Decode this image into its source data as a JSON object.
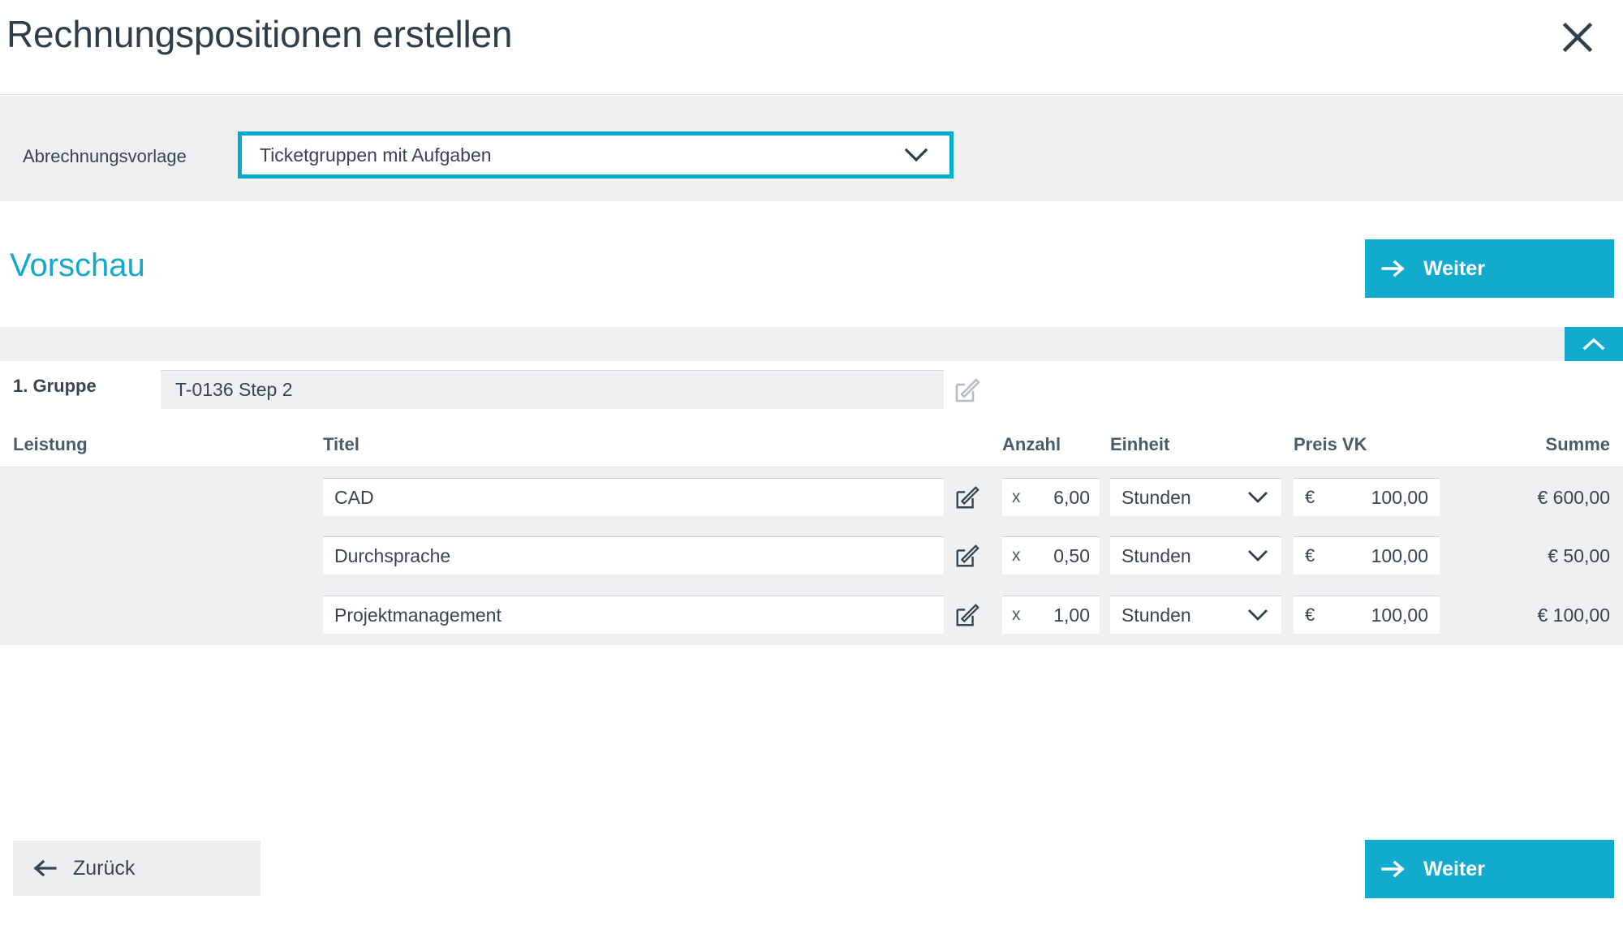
{
  "header": {
    "title": "Rechnungspositionen erstellen",
    "close_icon": "close-icon"
  },
  "template_bar": {
    "label": "Abrechnungsvorlage",
    "select": {
      "value": "Ticketgruppen mit Aufgaben",
      "chevron_icon": "chevron-down-icon",
      "highlight_color": "#00ABCF"
    }
  },
  "preview": {
    "title": "Vorschau",
    "title_color": "#14A8CC",
    "next_button": {
      "label": "Weiter",
      "icon": "arrow-right-icon",
      "color": "#12ABCE"
    },
    "collapse_button": {
      "icon": "chevron-up-icon",
      "color": "#12ABCE"
    }
  },
  "group": {
    "label": "1. Gruppe",
    "value": "T-0136 Step 2",
    "edit_icon": "edit-pencil-icon"
  },
  "table": {
    "columns": [
      "Leistung",
      "Titel",
      "Anzahl",
      "Einheit",
      "Preis VK",
      "Summe"
    ],
    "rows": [
      {
        "leistung": "",
        "titel": "CAD",
        "edit_icon": "edit-pencil-icon",
        "anzahl_prefix": "x",
        "anzahl": "6,00",
        "einheit": "Stunden",
        "einheit_chevron": "chevron-down-icon",
        "preis_currency": "€",
        "preis": "100,00",
        "summe": "€ 600,00"
      },
      {
        "leistung": "",
        "titel": "Durchsprache",
        "edit_icon": "edit-pencil-icon",
        "anzahl_prefix": "x",
        "anzahl": "0,50",
        "einheit": "Stunden",
        "einheit_chevron": "chevron-down-icon",
        "preis_currency": "€",
        "preis": "100,00",
        "summe": "€ 50,00"
      },
      {
        "leistung": "",
        "titel": "Projektmanagement",
        "edit_icon": "edit-pencil-icon",
        "anzahl_prefix": "x",
        "anzahl": "1,00",
        "einheit": "Stunden",
        "einheit_chevron": "chevron-down-icon",
        "preis_currency": "€",
        "preis": "100,00",
        "summe": "€ 100,00"
      }
    ]
  },
  "footer": {
    "back_button": {
      "label": "Zurück",
      "icon": "arrow-left-icon"
    },
    "next_button": {
      "label": "Weiter",
      "icon": "arrow-right-icon",
      "color": "#12ABCE"
    }
  }
}
